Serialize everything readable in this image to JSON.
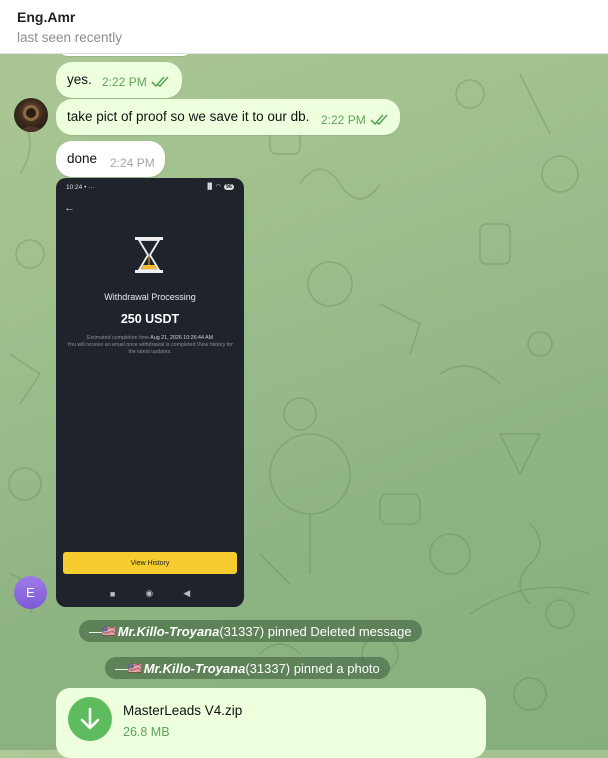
{
  "header": {
    "name": "Eng.Amr",
    "status": "last seen recently"
  },
  "messages": [
    {
      "text": "yes.",
      "time": "2:22 PM"
    },
    {
      "text": "take pict of proof so we save it to our db.",
      "time": "2:22 PM"
    },
    {
      "text": "done",
      "time": "2:24 PM"
    }
  ],
  "avatar": {
    "letter": "E"
  },
  "phone": {
    "status_time": "10:24",
    "status_dots": "• ···",
    "signal": "▐▌ ◠",
    "battery": "96",
    "title": "Withdrawal Processing",
    "amount": "250 USDT",
    "est_label": "Estimated completion time",
    "est_time": "Aug 21, 2026 10:26:44 AM",
    "est_note": "You will receive an email once withdrawal is completed.View history for the latest updates.",
    "button": "View History"
  },
  "service": [
    {
      "prefix": "—",
      "flag": "🇺🇸",
      "name": "Mr.Killo-Troyana",
      "rest": " (31337) pinned Deleted message"
    },
    {
      "prefix": "—",
      "flag": "🇺🇸",
      "name": "Mr.Killo-Troyana",
      "rest": " (31337) pinned a photo"
    }
  ],
  "file": {
    "name": "MasterLeads V4.zip",
    "size": "26.8 MB"
  },
  "colors": {
    "accent_green": "#5ebb5e",
    "out_bubble": "#eeffde",
    "service_bg": "#3c5e3a",
    "button_yellow": "#f6cc2e"
  }
}
